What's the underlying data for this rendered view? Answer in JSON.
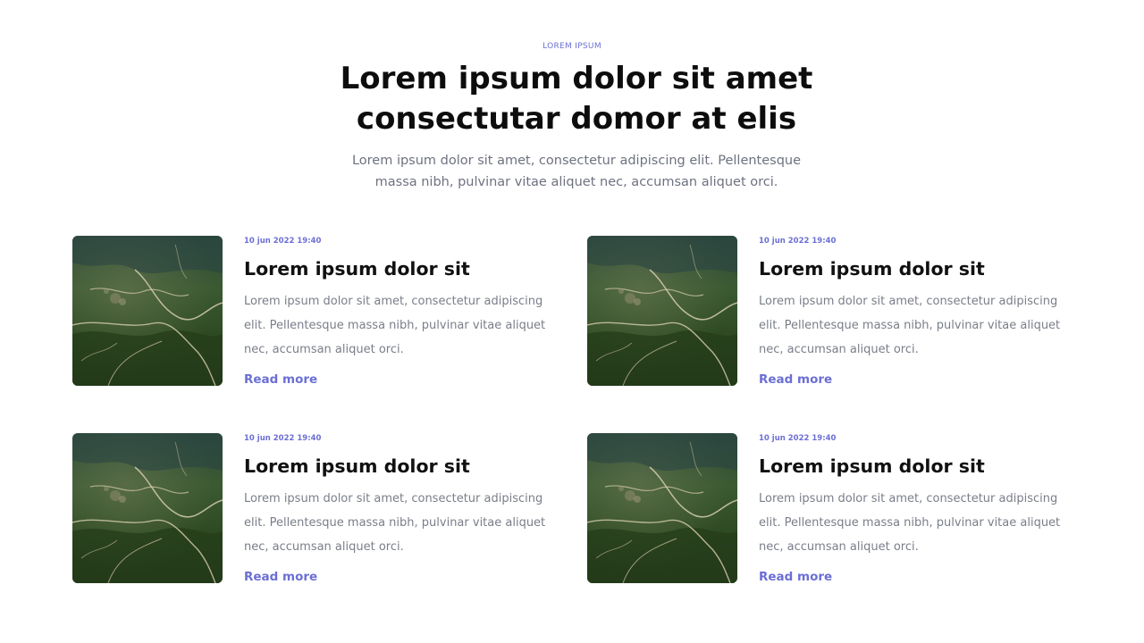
{
  "header": {
    "eyebrow": "LOREM IPSUM",
    "title_line1": "Lorem ipsum dolor sit amet",
    "title_line2": "consectutar domor at elis",
    "subtitle": "Lorem ipsum dolor sit amet, consectetur adipiscing elit. Pellentesque massa nibh, pulvinar vitae aliquet nec, accumsan aliquet orci."
  },
  "posts": [
    {
      "date": "10 jun 2022 19:40",
      "title": "Lorem ipsum dolor sit",
      "excerpt": "Lorem ipsum dolor sit amet, consectetur adipiscing elit. Pellentesque massa nibh, pulvinar vitae aliquet nec, accumsan aliquet orci.",
      "link_label": "Read more"
    },
    {
      "date": "10 jun 2022 19:40",
      "title": "Lorem ipsum dolor sit",
      "excerpt": "Lorem ipsum dolor sit amet, consectetur adipiscing elit. Pellentesque massa nibh, pulvinar vitae aliquet nec, accumsan aliquet orci.",
      "link_label": "Read more"
    },
    {
      "date": "10 jun 2022 19:40",
      "title": "Lorem ipsum dolor sit",
      "excerpt": "Lorem ipsum dolor sit amet, consectetur adipiscing elit. Pellentesque massa nibh, pulvinar vitae aliquet nec, accumsan aliquet orci.",
      "link_label": "Read more"
    },
    {
      "date": "10 jun 2022 19:40",
      "title": "Lorem ipsum dolor sit",
      "excerpt": "Lorem ipsum dolor sit amet, consectetur adipiscing elit. Pellentesque massa nibh, pulvinar vitae aliquet nec, accumsan aliquet orci.",
      "link_label": "Read more"
    }
  ],
  "colors": {
    "accent": "#6b6fd4",
    "heading": "#111111",
    "body_text": "#7a7e89"
  }
}
